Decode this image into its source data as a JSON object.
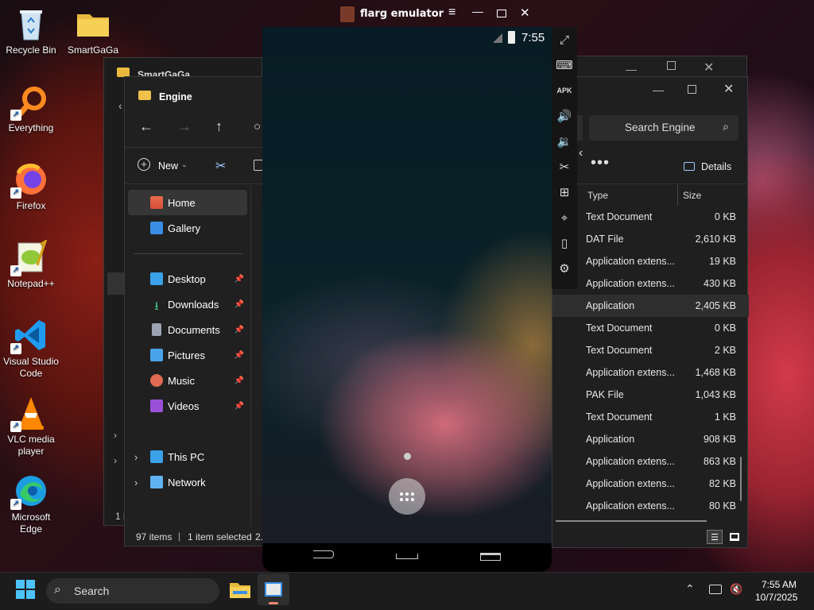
{
  "desktop_icons": [
    {
      "label": "Recycle Bin"
    },
    {
      "label": "SmartGaGa"
    },
    {
      "label": "Everything"
    },
    {
      "label": "Firefox"
    },
    {
      "label": "Notepad++"
    },
    {
      "label": "Visual Studio Code"
    },
    {
      "label": "VLC media player"
    },
    {
      "label": "Microsoft Edge"
    }
  ],
  "back_window": {
    "title": "SmartGaGa",
    "status": "1 i"
  },
  "engine_window": {
    "title": "Engine",
    "new_label": "New",
    "nav": {
      "home": "Home",
      "gallery": "Gallery",
      "desktop": "Desktop",
      "downloads": "Downloads",
      "documents": "Documents",
      "pictures": "Pictures",
      "music": "Music",
      "videos": "Videos",
      "this_pc": "This PC",
      "network": "Network"
    },
    "status_items": "97 items",
    "status_selected": "1 item selected",
    "status_trunc": "2."
  },
  "right_window": {
    "search_placeholder": "Search Engine",
    "details_label": "Details",
    "col_type": "Type",
    "col_size": "Size",
    "rows": [
      {
        "type": "Text Document",
        "size": "0 KB"
      },
      {
        "type": "DAT File",
        "size": "2,610 KB"
      },
      {
        "type": "Application extens...",
        "size": "19 KB"
      },
      {
        "type": "Application extens...",
        "size": "430 KB"
      },
      {
        "type": "Application",
        "size": "2,405 KB"
      },
      {
        "type": "Text Document",
        "size": "0 KB"
      },
      {
        "type": "Text Document",
        "size": "2 KB"
      },
      {
        "type": "Application extens...",
        "size": "1,468 KB"
      },
      {
        "type": "PAK File",
        "size": "1,043 KB"
      },
      {
        "type": "Text Document",
        "size": "1 KB"
      },
      {
        "type": "Application",
        "size": "908 KB"
      },
      {
        "type": "Application extens...",
        "size": "863 KB"
      },
      {
        "type": "Application extens...",
        "size": "82 KB"
      },
      {
        "type": "Application extens...",
        "size": "80 KB"
      }
    ]
  },
  "emulator": {
    "title": "flarg emulator",
    "clock": "7:55"
  },
  "taskbar": {
    "search_label": "Search",
    "time": "7:55 AM",
    "date": "10/7/2025"
  }
}
